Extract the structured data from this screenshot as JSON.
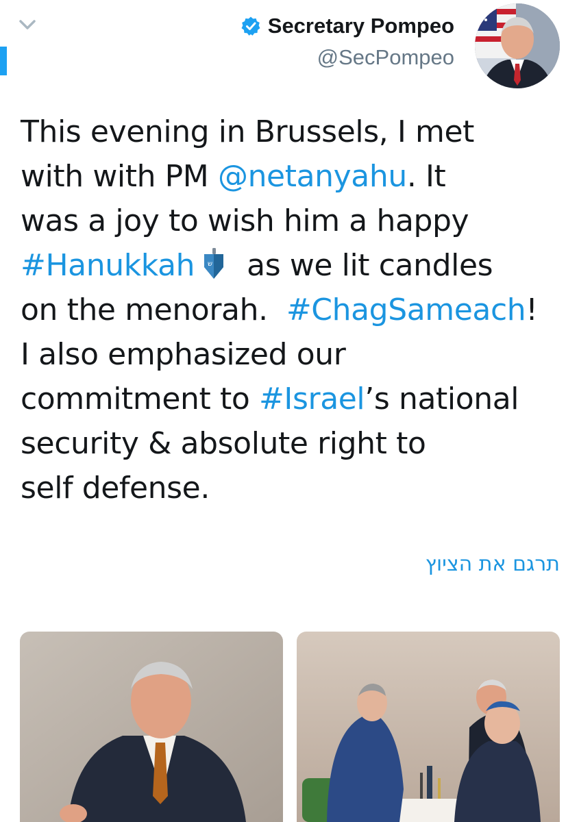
{
  "header": {
    "display_name": "Secretary Pompeo",
    "handle": "@SecPompeo",
    "verified": true
  },
  "icons": {
    "collapse": "chevron-down-icon",
    "verified": "verified-badge-icon",
    "emoji": "dreidel-emoji-icon"
  },
  "tweet": {
    "l1": "This evening in Brussels, I met",
    "l2_pre": "with with PM ",
    "l2_mention": "@netanyahu",
    "l2_post": ". It",
    "l3": "was a joy to wish him a happy",
    "l4_hashtag": "#Hanukkah",
    "l4_post": "as we lit candles",
    "l5_pre": "on the menorah.  ",
    "l5_hashtag": "#ChagSameach",
    "l5_post": "!",
    "l6": "I also emphasized our",
    "l7_pre": "commitment to ",
    "l7_hashtag": "#Israel",
    "l7_post": "’s national",
    "l8": "security & absolute right to",
    "l9": "self defense."
  },
  "translate_label": "תרגם את הציוץ",
  "colors": {
    "link": "#1b95e0",
    "text": "#14171a",
    "secondary": "#657786",
    "accent": "#1da1f2"
  }
}
